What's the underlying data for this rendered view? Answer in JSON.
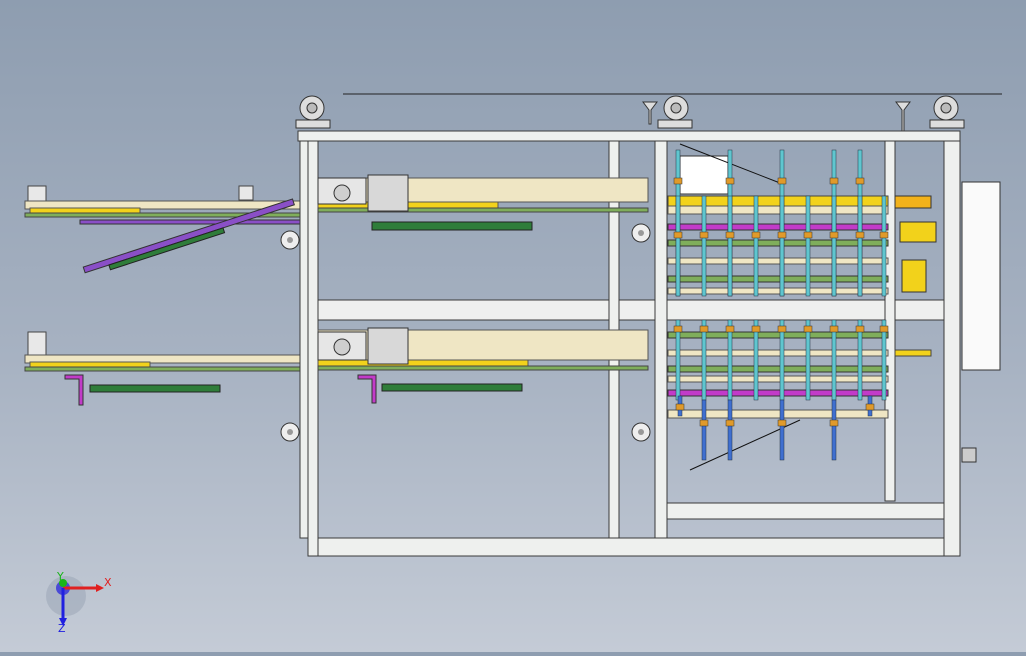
{
  "viewport": {
    "background_top": "#8e9db0",
    "background_bottom": "#c4cbd6"
  },
  "colors": {
    "frame_fill": "#eef0ee",
    "frame_stroke": "#3a3a3a",
    "wood": "#efe6c4",
    "belt_yellow": "#f2d21b",
    "belt_green": "#7fae5b",
    "purple": "#8a4fc7",
    "magenta": "#c23bc9",
    "rod_teal": "#5fc6cf",
    "nut_orange": "#e09a2a",
    "rod_blue": "#3f6fd0",
    "dark_green": "#2f7d3a"
  },
  "triad": {
    "x_label": "X",
    "y_label": "Y",
    "z_label": "Z",
    "x_color": "#e02020",
    "y_color": "#19b419",
    "z_color": "#2020e0"
  }
}
